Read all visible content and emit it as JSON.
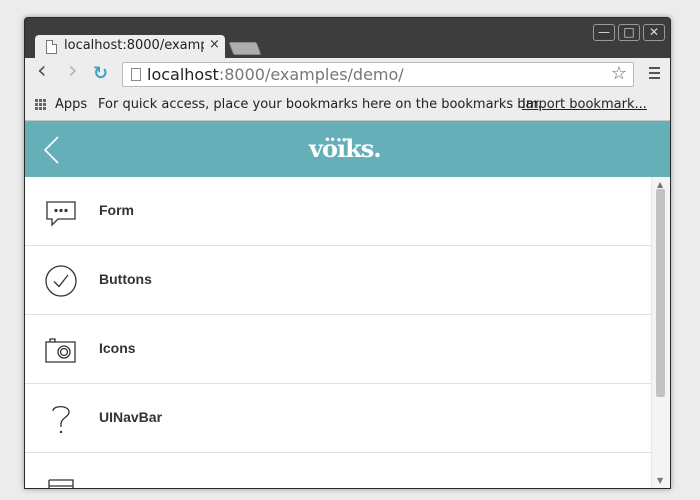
{
  "browser": {
    "tab": {
      "title": "localhost:8000/examp",
      "close": "×"
    },
    "window_controls": {
      "minimize": "—",
      "maximize": "□",
      "close": "✕"
    },
    "nav": {
      "back": "‹",
      "forward": "›",
      "reload": "↻"
    },
    "address": {
      "host": "localhost",
      "path": ":8000/examples/demo/"
    },
    "bookmarks": {
      "apps_label": "Apps",
      "hint": "For quick access, place your bookmarks here on the bookmarks bar.",
      "import_link": "Import bookmark..."
    }
  },
  "app": {
    "header": {
      "logo": "vöïks."
    },
    "items": [
      {
        "label": "Form",
        "icon": "chat-bubble-icon"
      },
      {
        "label": "Buttons",
        "icon": "check-circle-icon"
      },
      {
        "label": "Icons",
        "icon": "camera-icon"
      },
      {
        "label": "UINavBar",
        "icon": "question-mark-icon"
      },
      {
        "label": "",
        "icon": "navbar-icon"
      }
    ]
  },
  "colors": {
    "header_bg": "#65afb9",
    "accent_reload": "#3aa5c2",
    "icon_stroke": "#333333"
  }
}
